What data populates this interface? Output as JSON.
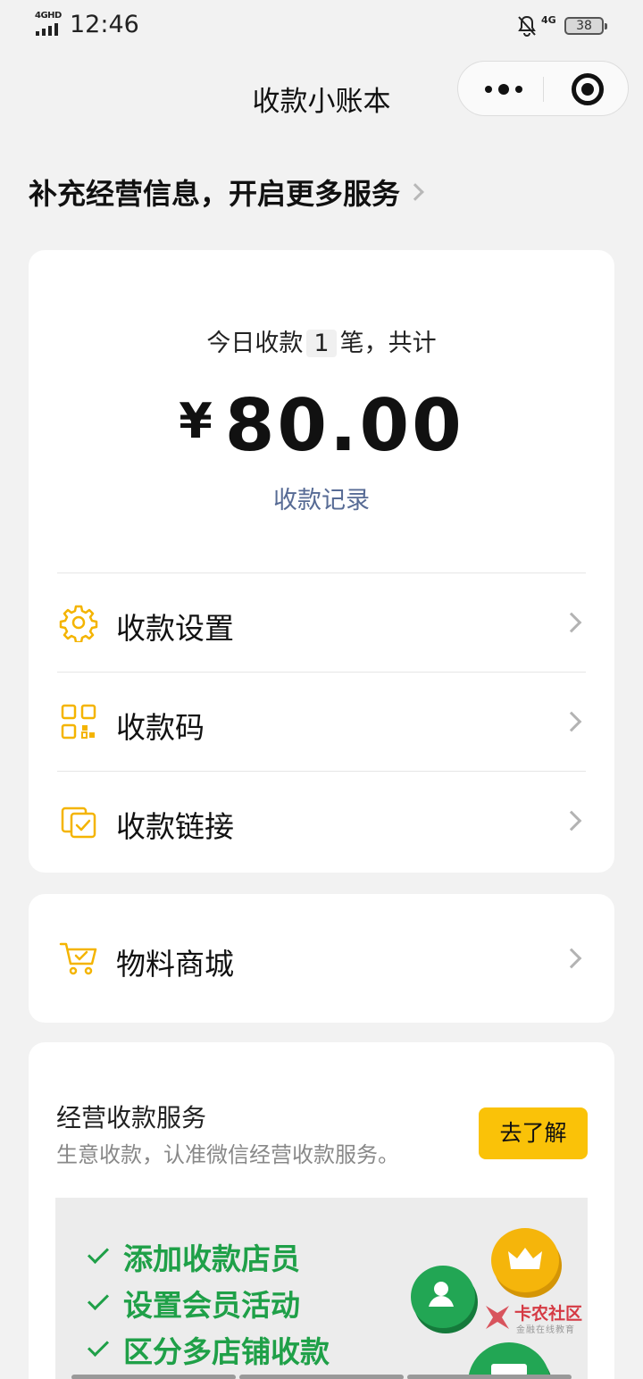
{
  "status_bar": {
    "network": "4GHD",
    "time": "12:46",
    "network2": "4G",
    "battery": "38"
  },
  "nav": {
    "title": "收款小账本"
  },
  "banner": {
    "text": "补充经营信息，开启更多服务"
  },
  "summary": {
    "prefix": "今日收款",
    "count": "1",
    "suffix": "笔，共计",
    "currency": "¥",
    "amount": "80.00",
    "records_link": "收款记录"
  },
  "menu": [
    {
      "label": "收款设置",
      "icon": "gear-icon"
    },
    {
      "label": "收款码",
      "icon": "qr-code-icon"
    },
    {
      "label": "收款链接",
      "icon": "link-icon"
    }
  ],
  "shop": {
    "label": "物料商城",
    "icon": "cart-icon"
  },
  "service": {
    "title": "经营收款服务",
    "description": "生意收款，认准微信经营收款服务。",
    "button": "去了解",
    "features": [
      "添加收款店员",
      "设置会员活动",
      "区分多店铺收款"
    ]
  },
  "watermark": {
    "name": "卡农社区",
    "tagline": "金融在线教育"
  },
  "colors": {
    "accent_yellow": "#fac208",
    "link_blue": "#576b95",
    "feature_green": "#1fa048",
    "background": "#f2f2f2"
  }
}
